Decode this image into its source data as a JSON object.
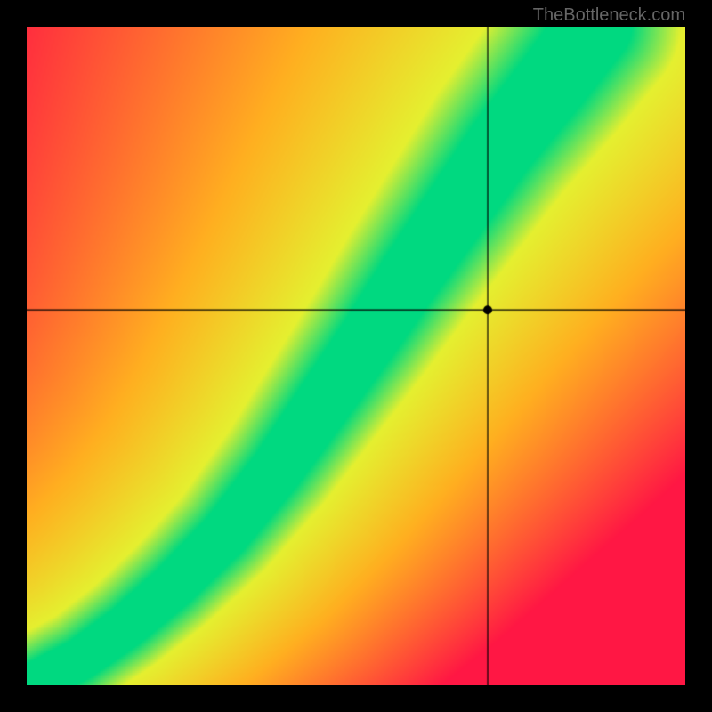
{
  "watermark": "TheBottleneck.com",
  "chart_data": {
    "type": "heatmap",
    "title": "",
    "xlabel": "",
    "ylabel": "",
    "xlim": [
      0,
      100
    ],
    "ylim": [
      0,
      100
    ],
    "marker": {
      "x": 70,
      "y": 57
    },
    "crosshair": {
      "x": 70,
      "y": 57
    },
    "optimal_curve": [
      {
        "x": 0,
        "y": 0
      },
      {
        "x": 8,
        "y": 4
      },
      {
        "x": 15,
        "y": 9
      },
      {
        "x": 22,
        "y": 15
      },
      {
        "x": 30,
        "y": 23
      },
      {
        "x": 38,
        "y": 33
      },
      {
        "x": 45,
        "y": 43
      },
      {
        "x": 52,
        "y": 53
      },
      {
        "x": 58,
        "y": 62
      },
      {
        "x": 65,
        "y": 72
      },
      {
        "x": 72,
        "y": 82
      },
      {
        "x": 80,
        "y": 92
      },
      {
        "x": 86,
        "y": 100
      }
    ],
    "color_scale": {
      "optimal": "#00d980",
      "near": "#e5f030",
      "warm": "#ffb020",
      "mid": "#ff7a20",
      "far": "#ff1744"
    },
    "description": "Bottleneck heatmap showing compatibility curve. Green band indicates balanced pairing; red regions indicate severe bottleneck. Black dot marks current selection at approximately (70, 57), outside the optimal green band."
  }
}
